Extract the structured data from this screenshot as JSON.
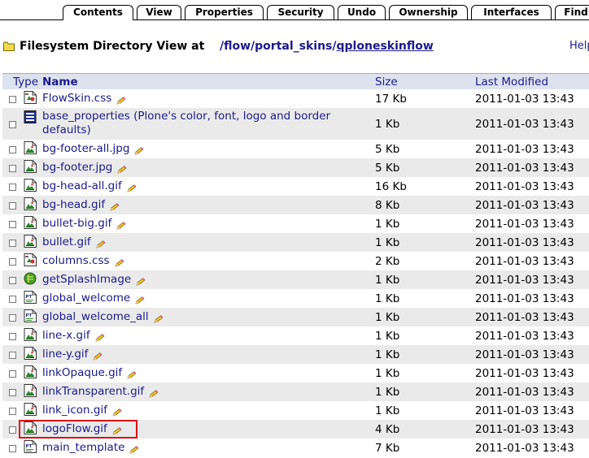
{
  "tabs": [
    {
      "label": "Contents",
      "active": true
    },
    {
      "label": "View",
      "active": false
    },
    {
      "label": "Properties",
      "active": false
    },
    {
      "label": "Security",
      "active": false
    },
    {
      "label": "Undo",
      "active": false
    },
    {
      "label": "Ownership",
      "active": false
    },
    {
      "label": "Interfaces",
      "active": false
    },
    {
      "label": "Find",
      "active": false
    }
  ],
  "heading": {
    "title": "Filesystem Directory View at",
    "path": [
      "/flow",
      "/portal_skins",
      "/qploneskinflow"
    ],
    "sep": "/"
  },
  "help_label": "Help!",
  "columns": {
    "type": "Type",
    "name": "Name",
    "size": "Size",
    "modified": "Last Modified"
  },
  "files": [
    {
      "name": "FlowSkin.css",
      "icon": "css-file-icon",
      "size": "17 Kb",
      "modified": "2011-01-03 13:43"
    },
    {
      "name": "base_properties (Plone's color, font, logo and border",
      "name2": "defaults)",
      "icon": "properties-file-icon",
      "size": "1 Kb",
      "modified": "2011-01-03 13:43"
    },
    {
      "name": "bg-footer-all.jpg",
      "icon": "image-file-icon",
      "size": "5 Kb",
      "modified": "2011-01-03 13:43"
    },
    {
      "name": "bg-footer.jpg",
      "icon": "image-file-icon",
      "size": "5 Kb",
      "modified": "2011-01-03 13:43"
    },
    {
      "name": "bg-head-all.gif",
      "icon": "image-file-icon",
      "size": "16 Kb",
      "modified": "2011-01-03 13:43"
    },
    {
      "name": "bg-head.gif",
      "icon": "image-file-icon",
      "size": "8 Kb",
      "modified": "2011-01-03 13:43"
    },
    {
      "name": "bullet-big.gif",
      "icon": "image-file-icon",
      "size": "1 Kb",
      "modified": "2011-01-03 13:43"
    },
    {
      "name": "bullet.gif",
      "icon": "image-file-icon",
      "size": "1 Kb",
      "modified": "2011-01-03 13:43"
    },
    {
      "name": "columns.css",
      "icon": "css-file-icon",
      "size": "2 Kb",
      "modified": "2011-01-03 13:43"
    },
    {
      "name": "getSplashImage",
      "icon": "python-script-icon",
      "size": "1 Kb",
      "modified": "2011-01-03 13:43"
    },
    {
      "name": "global_welcome",
      "icon": "page-template-icon",
      "size": "1 Kb",
      "modified": "2011-01-03 13:43"
    },
    {
      "name": "global_welcome_all",
      "icon": "page-template-icon",
      "size": "1 Kb",
      "modified": "2011-01-03 13:43"
    },
    {
      "name": "line-x.gif",
      "icon": "image-file-icon",
      "size": "1 Kb",
      "modified": "2011-01-03 13:43"
    },
    {
      "name": "line-y.gif",
      "icon": "image-file-icon",
      "size": "1 Kb",
      "modified": "2011-01-03 13:43"
    },
    {
      "name": "linkOpaque.gif",
      "icon": "image-file-icon",
      "size": "1 Kb",
      "modified": "2011-01-03 13:43"
    },
    {
      "name": "linkTransparent.gif",
      "icon": "image-file-icon",
      "size": "1 Kb",
      "modified": "2011-01-03 13:43"
    },
    {
      "name": "link_icon.gif",
      "icon": "image-file-icon",
      "size": "1 Kb",
      "modified": "2011-01-03 13:43"
    },
    {
      "name": "logoFlow.gif",
      "icon": "image-file-icon",
      "size": "4 Kb",
      "modified": "2011-01-03 13:43"
    },
    {
      "name": "main_template",
      "icon": "page-template-icon",
      "size": "7 Kb",
      "modified": "2011-01-03 13:43"
    }
  ],
  "colors": {
    "link": "#1a1a8c",
    "header_bg": "#dde3ee",
    "alt_row": "#eaeaea",
    "highlight": "#e01010"
  }
}
